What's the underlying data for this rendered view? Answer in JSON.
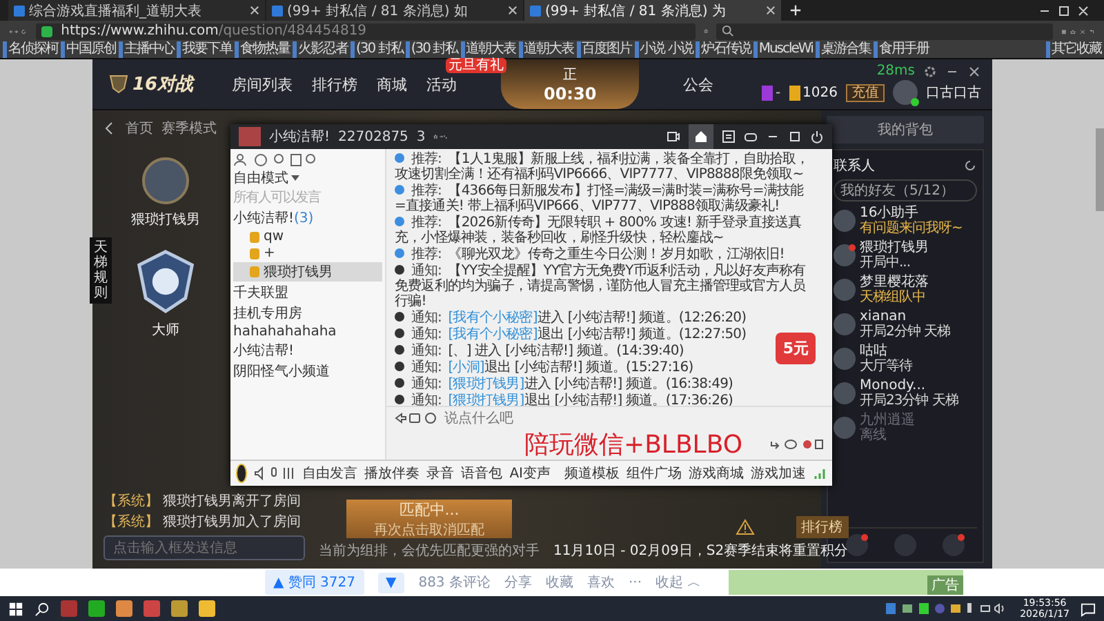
{
  "browser": {
    "tabs": [
      {
        "title": "综合游戏直播福利_道朝大表",
        "selected": false
      },
      {
        "title": "(99+ 封私信 / 81 条消息) 如",
        "selected": false
      },
      {
        "title": "(99+ 封私信 / 81 条消息) 为",
        "selected": true
      }
    ],
    "url_host": "https://www.zhihu.com",
    "url_path": "/question/484454819",
    "bookmarks": [
      "名侦探柯",
      "中国原创",
      "主播中心",
      "我要下单",
      "食物热量",
      "火影忍者",
      "(30 封私",
      "(30 封私",
      "道朝大表",
      "道朝大表",
      "百度图片",
      "小说 小说",
      "炉石传说",
      "MuscleWi",
      "桌游合集",
      "食用手册"
    ],
    "other_bookmarks": "其它收藏"
  },
  "game": {
    "logo": "16对战",
    "nav": [
      {
        "label": "房间列表"
      },
      {
        "label": "排行榜"
      },
      {
        "label": "商城"
      },
      {
        "label": "活动",
        "badge": "元旦有礼"
      },
      {
        "label": "公会"
      }
    ],
    "timer": {
      "mark": "正",
      "time": "00:30"
    },
    "gems": "-",
    "coins": "1026",
    "recharge": "充值",
    "ping": "28ms",
    "user_name": "口古口古",
    "breadcrumb": [
      "首页",
      "赛季模式"
    ],
    "player_name": "猥琐打钱男",
    "rank": "大师",
    "ladder_rules": "天梯规则",
    "system_messages": [
      {
        "tag": "【系统】",
        "text": "猥琐打钱男离开了房间"
      },
      {
        "tag": "【系统】",
        "text": "猥琐打钱男加入了房间"
      }
    ],
    "chat_placeholder": "点击输入框发送信息",
    "match": {
      "title": "匹配中...",
      "subtitle": "再次点击取消匹配",
      "hint": "当前为组排，会优先匹配更强的对手"
    },
    "season_note": "11月10日 - 02月09日，S2赛季结束将重置积分",
    "leaderboard": "排行榜",
    "backpack": "我的背包",
    "contacts_title": "联系人",
    "friend_search": "我的好友（5/12）",
    "contacts": [
      {
        "name": "16小助手",
        "status": "有问题来问我呀~",
        "kind": "team",
        "unread": false
      },
      {
        "name": "猥琐打钱男",
        "status": "开局中...",
        "kind": "playing",
        "unread": true
      },
      {
        "name": "梦里樱花落",
        "status": "天梯组队中",
        "kind": "team",
        "unread": false
      },
      {
        "name": "xianan",
        "status": "开局2分钟 天梯",
        "kind": "playing",
        "unread": false
      },
      {
        "name": "咕咕",
        "status": "大厅等待",
        "kind": "playing",
        "unread": false
      },
      {
        "name": "Monody...",
        "status": "开局23分钟 天梯",
        "kind": "playing",
        "unread": false
      },
      {
        "name": "九州逍遥",
        "status": "离线",
        "kind": "offline",
        "unread": false
      }
    ],
    "bottom_buttons": [
      {
        "unread": true
      },
      {
        "unread": false
      },
      {
        "unread": true
      }
    ]
  },
  "yy": {
    "channel_name": "小纯洁帮!",
    "channel_id": "22702875",
    "members": "3",
    "mode": "自由模式",
    "speak_rule": "所有人可以发言",
    "tree": [
      {
        "name": "小纯洁帮!",
        "count": "(3)",
        "children": [
          {
            "name": "qw",
            "selected": false
          },
          {
            "name": "+",
            "selected": false
          },
          {
            "name": "猥琐打钱男",
            "selected": true
          }
        ]
      },
      {
        "name": "千夫联盟"
      },
      {
        "name": "挂机专用房"
      },
      {
        "name": "hahahahahaha"
      },
      {
        "name": "小纯洁帮!"
      },
      {
        "name": "阴阳怪气小频道"
      }
    ],
    "messages": [
      {
        "kind": "info",
        "label": "推荐:",
        "text": "【1人1鬼服】新服上线，福利拉满，装备全靠打，自助拾取，攻速切割全满！还有福利码VIP6666、VIP7777、VIP8888限免领取~"
      },
      {
        "kind": "info",
        "label": "推荐:",
        "text": "【4366每日新服发布】打怪=满级=满时装=满称号=满技能=直接通关! 带上福利码VIP666、VIP777、VIP888领取满级豪礼!"
      },
      {
        "kind": "info",
        "label": "推荐:",
        "text": "【2026新传奇】无限转职 + 800% 攻速! 新手登录直接送真充，小怪爆神装，装备秒回收，刷怪升级快，轻松鏖战~"
      },
      {
        "kind": "info",
        "label": "推荐:",
        "text": "《聊光双龙》传奇之重生今日公测！岁月如歌，江湖依旧!"
      },
      {
        "kind": "notice",
        "label": "通知:",
        "text": "【YY安全提醒】YY官方无免费Y币返利活动，凡以好友声称有免费返利的均为骗子，请提高警惕，谨防他人冒充主播管理或官方人员行骗!"
      },
      {
        "kind": "notice",
        "label": "通知:",
        "name": "[我有个小秘密]",
        "text": "进入 [小纯洁帮!] 频道。(12:26:20)"
      },
      {
        "kind": "notice",
        "label": "通知:",
        "name": "[我有个小秘密]",
        "text": "退出 [小纯洁帮!] 频道。(12:27:50)"
      },
      {
        "kind": "notice",
        "label": "通知:",
        "text": "[、] 进入 [小纯洁帮!] 频道。(14:39:40)"
      },
      {
        "kind": "notice",
        "label": "通知:",
        "name": "[小洞]",
        "text": "退出 [小纯洁帮!] 频道。(15:27:16)"
      },
      {
        "kind": "notice",
        "label": "通知:",
        "name": "[猥琐打钱男]",
        "text": "进入 [小纯洁帮!] 频道。(16:38:49)"
      },
      {
        "kind": "notice",
        "label": "通知:",
        "name": "[猥琐打钱男]",
        "text": "退出 [小纯洁帮!] 频道。(17:36:26)"
      }
    ],
    "red_packet": "5元",
    "input_placeholder": "说点什么吧",
    "overlay_text": "陪玩微信+BLBLBO",
    "tools": [
      "自由发言",
      "播放伴奏",
      "录音",
      "语音包",
      "AI变声"
    ],
    "apps": [
      "频道模板",
      "组件广场",
      "游戏商城",
      "游戏加速"
    ]
  },
  "answer_bar": {
    "upvote": "▲ 赞同 3727",
    "downvote": "▼",
    "comments": "883 条评论",
    "share": "分享",
    "favorite": "收藏",
    "like": "喜欢",
    "more": "···",
    "collapse": "收起 ︿",
    "ad": "广告"
  },
  "taskbar": {
    "time": "19:53:56",
    "date": "2026/1/17"
  }
}
